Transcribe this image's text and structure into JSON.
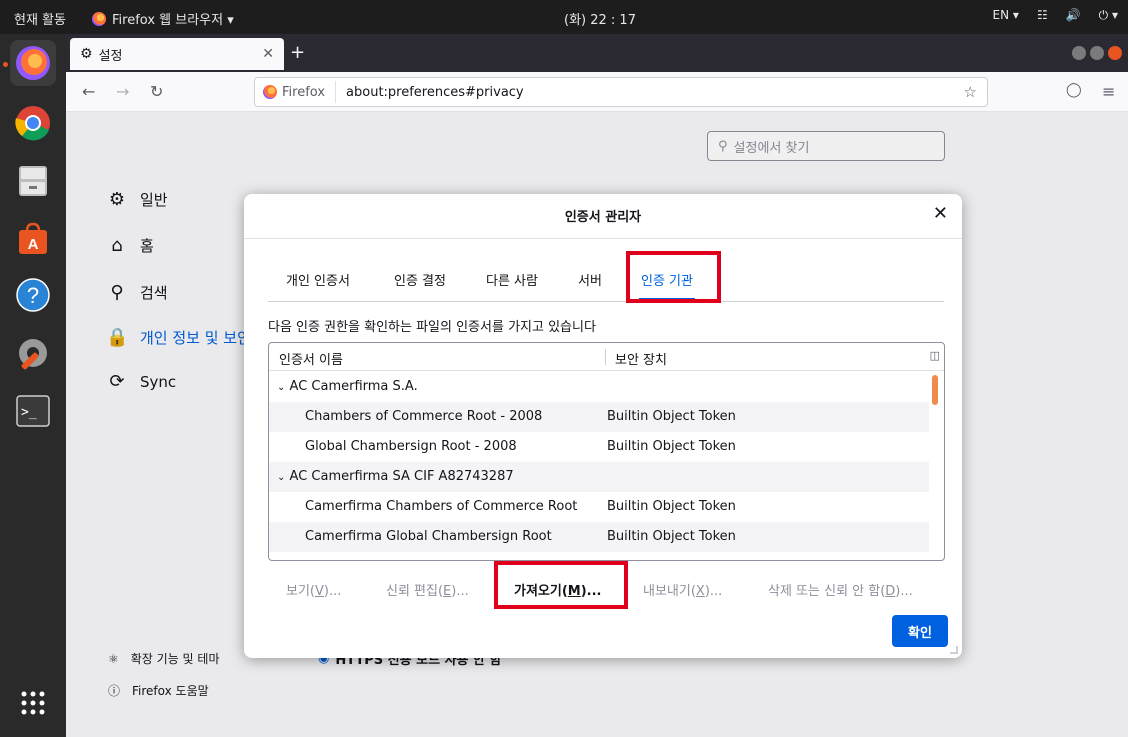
{
  "system_bar": {
    "activities": "현재 활동",
    "app_name": "Firefox 웹 브라우저 ▾",
    "clock": "(화) 22 : 17",
    "lang": "EN ▾",
    "tray": "⏻ ▾"
  },
  "dock": {
    "items": [
      "firefox",
      "chrome",
      "files",
      "software",
      "help",
      "settings",
      "terminal",
      "show-apps"
    ]
  },
  "browser": {
    "tab_title": "설정",
    "identity_label": "Firefox",
    "url": "about:preferences#privacy"
  },
  "prefs": {
    "search_placeholder": "설정에서 찾기",
    "categories": [
      {
        "label": "일반",
        "icon": "gear-icon"
      },
      {
        "label": "홈",
        "icon": "home-icon"
      },
      {
        "label": "검색",
        "icon": "search-icon"
      },
      {
        "label": "개인 정보 및 보안",
        "icon": "lock-icon",
        "selected": true
      },
      {
        "label": "Sync",
        "icon": "sync-icon"
      }
    ],
    "bottom_links": [
      "확장 기능 및 테마",
      "Firefox 도움말"
    ],
    "behind_text": "HTTPS 전용 모드 사용 안 함"
  },
  "cert_manager": {
    "title": "인증서 관리자",
    "tabs": [
      "개인 인증서",
      "인증 결정",
      "다른 사람",
      "서버",
      "인증 기관"
    ],
    "selected_tab": "인증 기관",
    "description": "다음 인증 권한을 확인하는 파일의 인증서를 가지고 있습니다",
    "columns": [
      "인증서 이름",
      "보안 장치"
    ],
    "rows": [
      {
        "kind": "group",
        "name": "AC Camerfirma S.A.",
        "token": ""
      },
      {
        "kind": "cert",
        "name": "Chambers of Commerce Root - 2008",
        "token": "Builtin Object Token"
      },
      {
        "kind": "cert",
        "name": "Global Chambersign Root - 2008",
        "token": "Builtin Object Token"
      },
      {
        "kind": "group",
        "name": "AC Camerfirma SA CIF A82743287",
        "token": ""
      },
      {
        "kind": "cert",
        "name": "Camerfirma Chambers of Commerce Root",
        "token": "Builtin Object Token"
      },
      {
        "kind": "cert",
        "name": "Camerfirma Global Chambersign Root",
        "token": "Builtin Object Token"
      }
    ],
    "buttons": {
      "view": {
        "label": "보기(",
        "key": "V",
        "suffix": ")..."
      },
      "edit_trust": {
        "label": "신뢰 편집(",
        "key": "E",
        "suffix": ")..."
      },
      "import": {
        "label": "가져오기(",
        "key": "M",
        "suffix": ")..."
      },
      "export": {
        "label": "내보내기(",
        "key": "X",
        "suffix": ")..."
      },
      "delete": {
        "label": "삭제 또는 신뢰 안 함(",
        "key": "D",
        "suffix": ")..."
      }
    },
    "ok_label": "확인"
  },
  "colors": {
    "accent": "#0061e0",
    "highlight": "#e0001b",
    "ubuntu_orange": "#e95420"
  }
}
